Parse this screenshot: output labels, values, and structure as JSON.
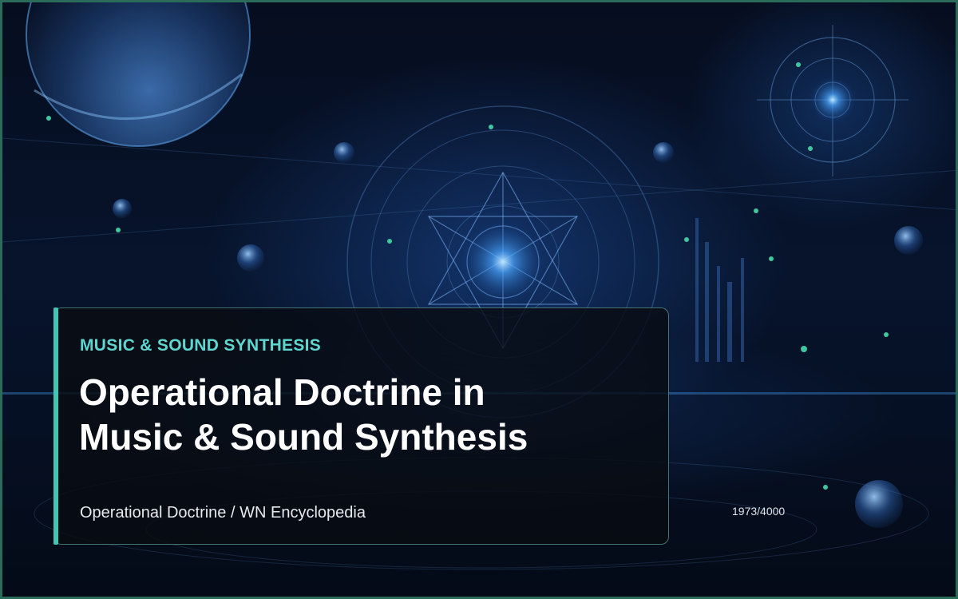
{
  "card": {
    "category": "MUSIC & SOUND SYNTHESIS",
    "title_line1": "Operational Doctrine in",
    "title_line2": "Music & Sound Synthesis",
    "source": "Operational Doctrine / WN Encyclopedia"
  },
  "counter": "1973/4000",
  "colors": {
    "accent": "#3fc7b4",
    "kicker": "#5fd6cf",
    "frame": "#2a6b5a",
    "background": "#050a16"
  }
}
